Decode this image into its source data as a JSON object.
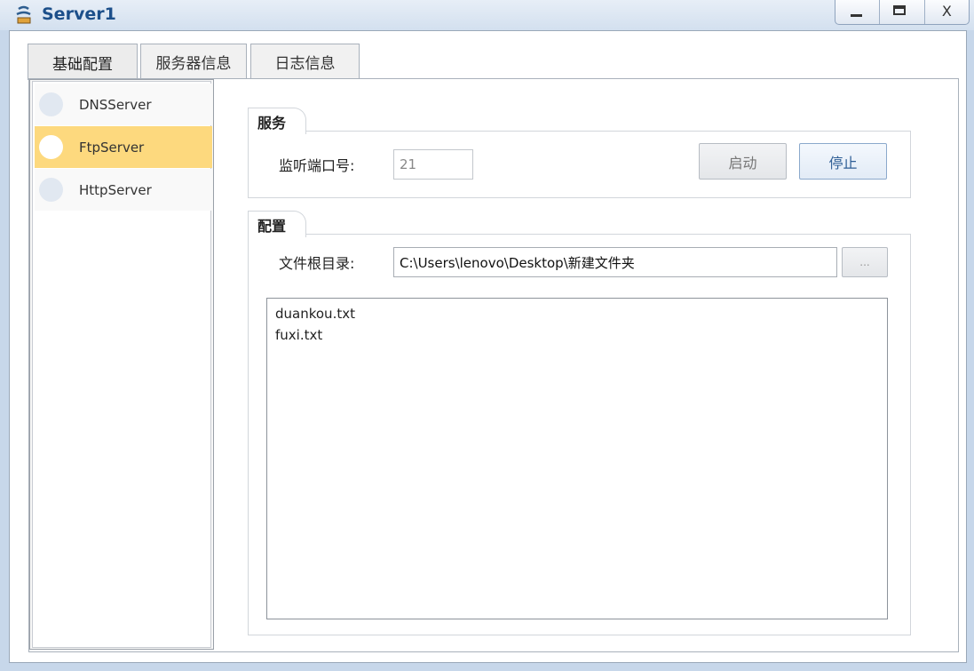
{
  "window": {
    "title": "Server1"
  },
  "window_controls": {
    "minimize": "_",
    "maximize": "□",
    "close": "X"
  },
  "tabs": [
    {
      "label": "基础配置",
      "active": true
    },
    {
      "label": "服务器信息",
      "active": false
    },
    {
      "label": "日志信息",
      "active": false
    }
  ],
  "sidebar": {
    "items": [
      {
        "label": "DNSServer",
        "selected": false
      },
      {
        "label": "FtpServer",
        "selected": true
      },
      {
        "label": "HttpServer",
        "selected": false
      }
    ]
  },
  "service_group": {
    "title": "服务",
    "port_label": "监听端口号:",
    "port_value": "21",
    "start_button": "启动",
    "stop_button": "停止"
  },
  "config_group": {
    "title": "配置",
    "root_label": "文件根目录:",
    "root_value": "C:\\Users\\lenovo\\Desktop\\新建文件夹",
    "browse_button": "...",
    "files": [
      "duankou.txt",
      "fuxi.txt"
    ]
  },
  "colors": {
    "selected_item": "#fdd97e",
    "title_text": "#1c4f8a",
    "window_frame": "#c7d7ea"
  }
}
